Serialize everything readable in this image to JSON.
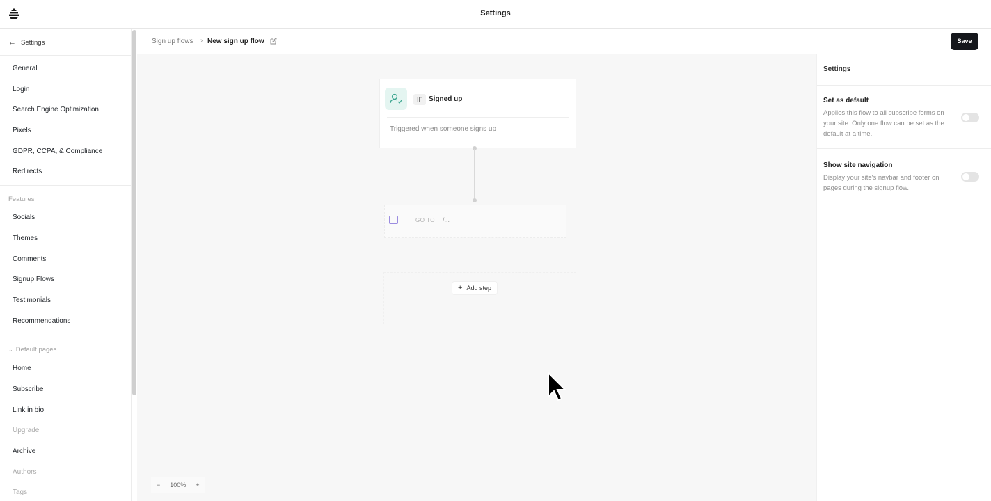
{
  "app": {
    "title": "Settings"
  },
  "sidebar": {
    "back_label": "Settings",
    "general_items": [
      "General",
      "Login",
      "Search Engine Optimization",
      "Pixels",
      "GDPR, CCPA, & Compliance",
      "Redirects"
    ],
    "features_label": "Features",
    "feature_items": [
      "Socials",
      "Themes",
      "Comments",
      "Signup Flows",
      "Testimonials",
      "Recommendations"
    ],
    "default_pages_label": "Default pages",
    "page_items": [
      "Home",
      "Subscribe",
      "Link in bio",
      "Upgrade",
      "Archive",
      "Authors",
      "Tags"
    ]
  },
  "breadcrumb": {
    "parent": "Sign up flows",
    "separator": "›",
    "current": "New sign up flow"
  },
  "toolbar": {
    "save_label": "Save"
  },
  "flow": {
    "trigger": {
      "badge": "IF",
      "title": "Signed up",
      "description": "Triggered when someone signs up"
    },
    "goto": {
      "label": "GO TO",
      "path": "/..."
    },
    "add_step_label": "Add step"
  },
  "zoom": {
    "minus": "−",
    "level": "100%",
    "plus": "+"
  },
  "settings_panel": {
    "title": "Settings",
    "options": [
      {
        "title": "Set as default",
        "description": "Applies this flow to all subscribe forms on your site. Only one flow can be set as the default at a time.",
        "enabled": false
      },
      {
        "title": "Show site navigation",
        "description": "Display your site's navbar and footer on pages during the signup flow.",
        "enabled": false
      }
    ]
  },
  "colors": {
    "accent": "#15171c",
    "trigger_icon_bg": "#e4f5f1",
    "canvas_bg": "#f7f7f7"
  }
}
